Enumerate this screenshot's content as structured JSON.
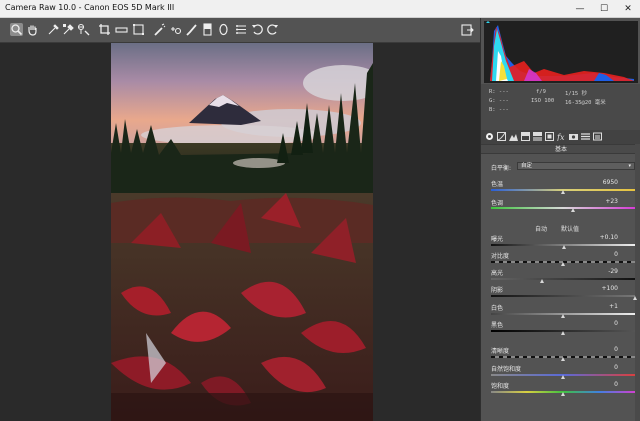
{
  "window": {
    "title": "Camera Raw 10.0  -  Canon EOS 5D Mark III"
  },
  "window_controls": {
    "minimize": "—",
    "maximize": "☐",
    "close": "✕"
  },
  "toolbar": {
    "tools": [
      "zoom-icon",
      "hand-icon",
      "white-balance-icon",
      "color-sampler-icon",
      "targeted-adjust-icon",
      "crop-icon",
      "straighten-icon",
      "transform-icon",
      "spot-removal-icon",
      "red-eye-icon",
      "adjustment-brush-icon",
      "graduated-filter-icon",
      "radial-filter-icon",
      "preferences-icon",
      "rotate-ccw-icon",
      "rotate-cw-icon"
    ],
    "active_tool": "zoom-icon",
    "export_icon": "open-object-icon"
  },
  "histogram": {
    "colors": {
      "red": "#e8201e",
      "blue": "#1f5fe6",
      "cyan": "#2fd8f0",
      "white": "#ffffff",
      "yellow": "#f4e03a",
      "magenta": "#d13ae0"
    }
  },
  "exif": {
    "r": "R:  ---",
    "g": "G:  ---",
    "b": "B:  ---",
    "aperture": "f/9",
    "shutter": "1/15 秒",
    "iso": "ISO 100",
    "lens": "16-35@20 毫米"
  },
  "panel_tabs": [
    "basic-icon",
    "tone-curve-icon",
    "detail-icon",
    "hsl-icon",
    "split-tone-icon",
    "lens-icon",
    "fx-icon",
    "camera-calibration-icon",
    "presets-icon",
    "snapshots-icon"
  ],
  "panel": {
    "section_title": "基本",
    "white_balance_label": "白平衡:",
    "white_balance_value": "自定",
    "temperature": {
      "label": "色温",
      "value": "6950",
      "level": 0.5
    },
    "tint": {
      "label": "色调",
      "value": "+23",
      "level": 0.57
    },
    "auto": "自动",
    "default": "默认值",
    "exposure": {
      "label": "曝光",
      "value": "+0.10",
      "level": 0.51
    },
    "contrast": {
      "label": "对比度",
      "value": "0",
      "level": 0.5
    },
    "highlights": {
      "label": "高光",
      "value": "-29",
      "level": 0.36
    },
    "shadows": {
      "label": "阴影",
      "value": "+100",
      "level": 1.0
    },
    "whites": {
      "label": "白色",
      "value": "+1",
      "level": 0.5
    },
    "blacks": {
      "label": "黑色",
      "value": "0",
      "level": 0.5
    },
    "clarity": {
      "label": "清晰度",
      "value": "0",
      "level": 0.5
    },
    "vibrance": {
      "label": "自然饱和度",
      "value": "0",
      "level": 0.5
    },
    "saturation": {
      "label": "饱和度",
      "value": "0",
      "level": 0.5
    }
  }
}
